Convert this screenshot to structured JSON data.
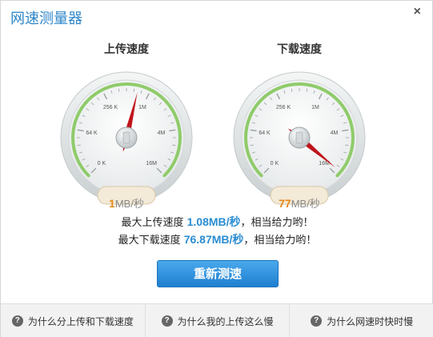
{
  "window": {
    "title": "网速测量器",
    "close_glyph": "×"
  },
  "gauges": {
    "upload": {
      "title": "上传速度",
      "readout_value": "1",
      "readout_unit": "MB/秒",
      "ticks": [
        "0 K",
        "64 K",
        "256 K",
        "1M",
        "4M",
        "16M"
      ],
      "needle_level": 0.55
    },
    "download": {
      "title": "下载速度",
      "readout_value": "77",
      "readout_unit": "MB/秒",
      "ticks": [
        "0 K",
        "64 K",
        "256 K",
        "1M",
        "4M",
        "16M"
      ],
      "needle_level": 0.98
    }
  },
  "summary": {
    "upload_prefix": "最大上传速度",
    "upload_value": "1.08MB/秒",
    "upload_suffix": "，相当给力哟！",
    "download_prefix": "最大下载速度",
    "download_value": "76.87MB/秒",
    "download_suffix": "，相当给力哟！"
  },
  "retest_button": "重新测速",
  "footer": {
    "items": [
      {
        "icon": "help-icon",
        "glyph": "?",
        "label": "为什么分上传和下载速度"
      },
      {
        "icon": "help-icon",
        "glyph": "?",
        "label": "为什么我的上传这么慢"
      },
      {
        "icon": "help-icon",
        "glyph": "?",
        "label": "为什么网速时快时慢"
      }
    ]
  },
  "colors": {
    "title": "#2e86c9",
    "needle": "#c0141b",
    "readout": "#e88a1a",
    "value_highlight": "#2a8cd2",
    "button": "#2a8cd2",
    "gauge_arc": "#8fcb6a"
  }
}
